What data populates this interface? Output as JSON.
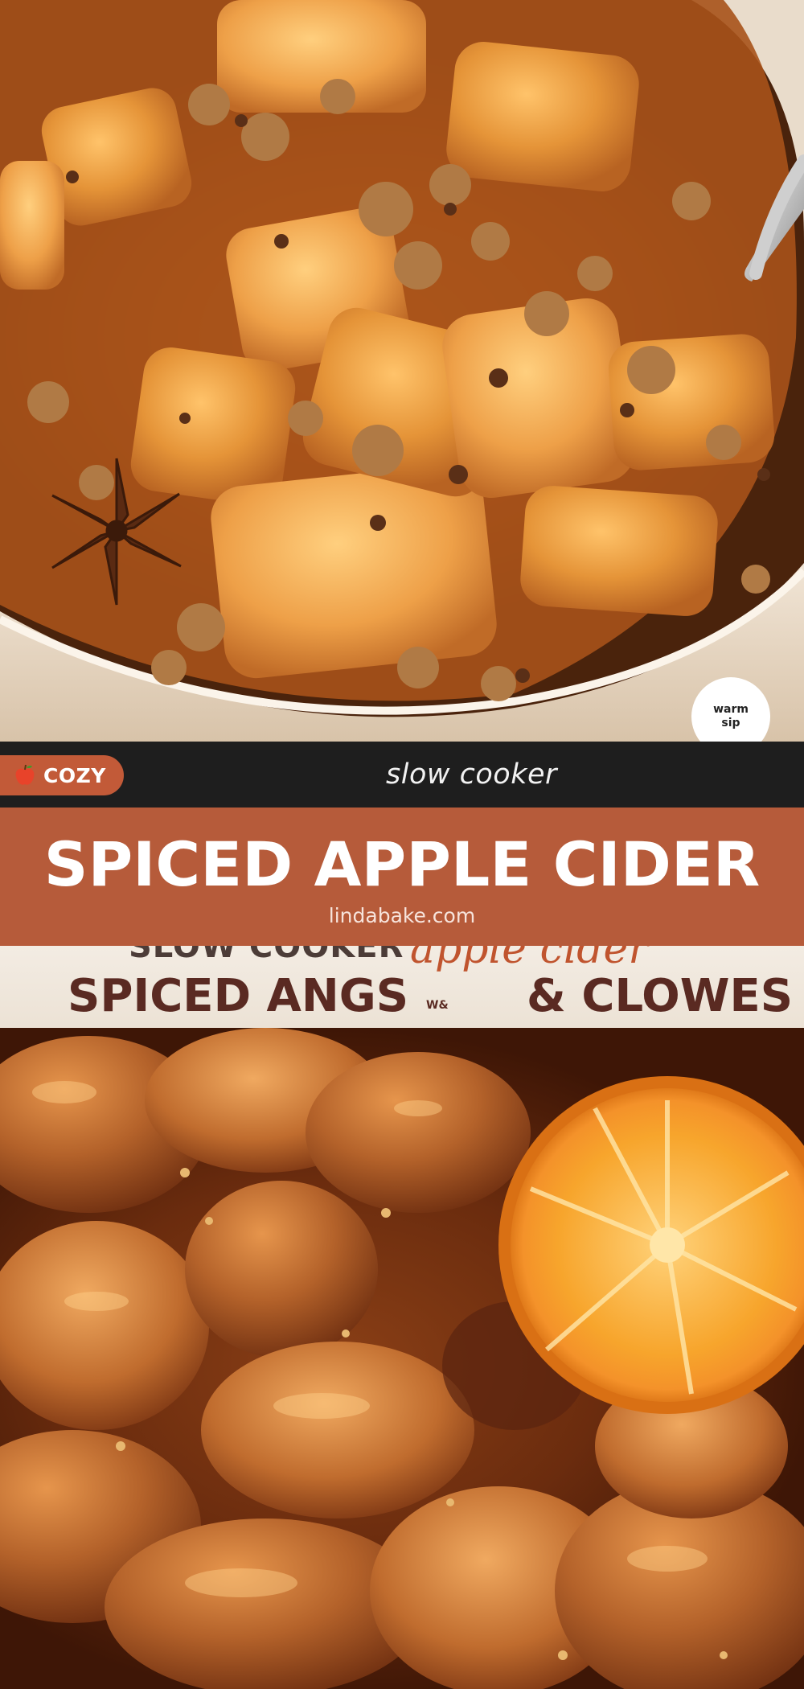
{
  "photo_top": {
    "alt": "spiced apple cider cobbler"
  },
  "badge": {
    "line1": "warm",
    "line2": "sip"
  },
  "bar": {
    "tag_label": "COZY",
    "tag_icon": "apple-icon",
    "subtitle": "slow cooker"
  },
  "banner": {
    "title": "SPICED APPLE CIDER",
    "site": "lindabake.com"
  },
  "strip": {
    "ghost_text": "SLOW COOKER",
    "ghost_script": "apple cider",
    "title": "SPICED ANGS",
    "tiny": "W&",
    "title_end": "& CLOWES"
  },
  "photo_bottom": {
    "alt": "braised apples with orange slice"
  },
  "colors": {
    "banner": "#b65b3a",
    "pill": "#c25a38",
    "bar": "#1e1e1e",
    "strip_text": "#5a2a22",
    "script_accent": "#c0542e"
  }
}
